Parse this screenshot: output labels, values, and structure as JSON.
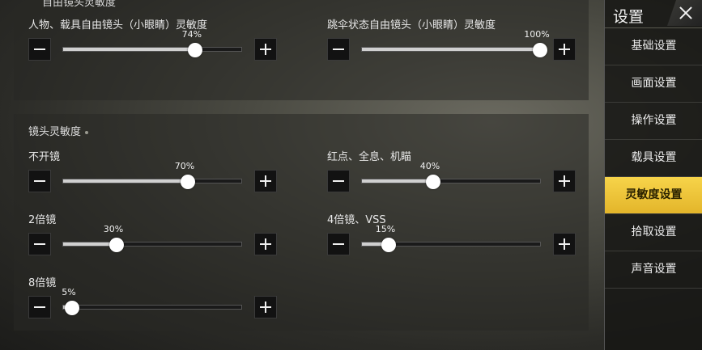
{
  "top_section_title_clipped": "自由镜头灵敏度",
  "top_controls": [
    {
      "label": "人物、载具自由镜头（小眼睛）灵敏度",
      "value_text": "74%",
      "value": 0.74
    },
    {
      "label": "跳伞状态自由镜头（小眼睛）灵敏度",
      "value_text": "100%",
      "value": 1.0
    }
  ],
  "scope_section": {
    "title": "镜头灵敏度",
    "controls": [
      {
        "label": "不开镜",
        "value_text": "70%",
        "value": 0.7
      },
      {
        "label": "红点、全息、机瞄",
        "value_text": "40%",
        "value": 0.4
      },
      {
        "label": "2倍镜",
        "value_text": "30%",
        "value": 0.3
      },
      {
        "label": "4倍镜、VSS",
        "value_text": "15%",
        "value": 0.15
      },
      {
        "label": "8倍镜",
        "value_text": "5%",
        "value": 0.05
      }
    ]
  },
  "sidebar": {
    "title": "设置",
    "close_icon": "close-icon",
    "items": [
      {
        "label": "基础设置",
        "active": false
      },
      {
        "label": "画面设置",
        "active": false
      },
      {
        "label": "操作设置",
        "active": false
      },
      {
        "label": "载具设置",
        "active": false
      },
      {
        "label": "灵敏度设置",
        "active": true
      },
      {
        "label": "拾取设置",
        "active": false
      },
      {
        "label": "声音设置",
        "active": false
      }
    ]
  },
  "colors": {
    "accent": "#f2c83c",
    "track_fill": "#d0d0d0",
    "button_bg": "#121212"
  }
}
